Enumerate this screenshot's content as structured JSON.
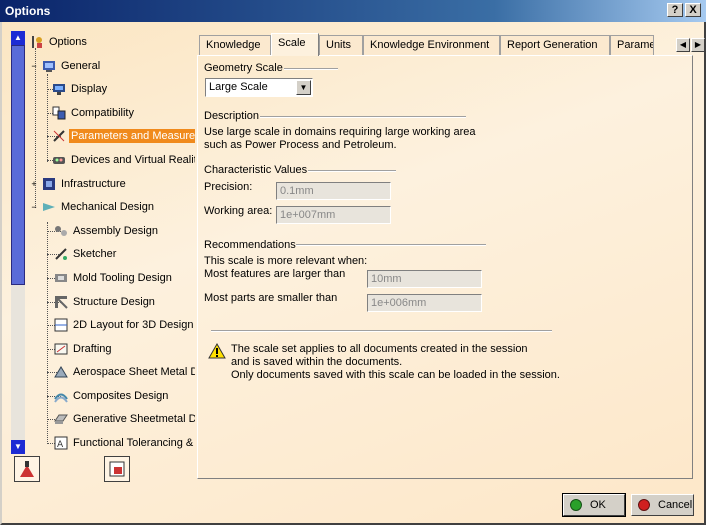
{
  "window": {
    "title": "Options",
    "help_btn": "?",
    "close_btn": "X"
  },
  "tree": {
    "items": [
      {
        "label": "Options"
      },
      {
        "label": "General"
      },
      {
        "label": "Display"
      },
      {
        "label": "Compatibility"
      },
      {
        "label": "Parameters and Measure"
      },
      {
        "label": "Devices and Virtual Reality"
      },
      {
        "label": "Infrastructure"
      },
      {
        "label": "Mechanical Design"
      },
      {
        "label": "Assembly Design"
      },
      {
        "label": "Sketcher"
      },
      {
        "label": "Mold Tooling Design"
      },
      {
        "label": "Structure Design"
      },
      {
        "label": "2D Layout for 3D Design"
      },
      {
        "label": "Drafting"
      },
      {
        "label": "Aerospace Sheet Metal  D"
      },
      {
        "label": "Composites Design"
      },
      {
        "label": "Generative Sheetmetal De"
      },
      {
        "label": "Functional Tolerancing & A"
      }
    ],
    "selected_index": 4
  },
  "tabs": [
    {
      "label": "Knowledge"
    },
    {
      "label": "Scale"
    },
    {
      "label": "Units"
    },
    {
      "label": "Knowledge Environment"
    },
    {
      "label": "Report Generation"
    },
    {
      "label": "Parame"
    }
  ],
  "active_tab": "Scale",
  "scale": {
    "geometry_scale_label": "Geometry Scale",
    "geometry_scale_value": "Large Scale",
    "description_label": "Description",
    "description_line1": "Use large scale in domains requiring large working area",
    "description_line2": "such as Power Process and Petroleum.",
    "characteristic_label": "Characteristic Values",
    "precision_label": "Precision:",
    "precision_value": "0.1mm",
    "working_area_label": "Working area:",
    "working_area_value": "1e+007mm",
    "recommendations_label": "Recommendations",
    "rec_line1": "This scale is more relevant when:",
    "rec_features_label": "Most features are larger than",
    "rec_features_value": "10mm",
    "rec_parts_label": "Most parts are smaller than",
    "rec_parts_value": "1e+006mm",
    "note_line1": "The scale set applies to all documents created in the session",
    "note_line2": "and is saved within the documents.",
    "note_line3": "Only documents saved with this scale can be loaded in the session."
  },
  "buttons": {
    "ok": "OK",
    "cancel": "Cancel"
  },
  "colors": {
    "selection": "#f08a1c",
    "titlebar": "#0a246a",
    "scrollbar": "#1d2bd4"
  }
}
